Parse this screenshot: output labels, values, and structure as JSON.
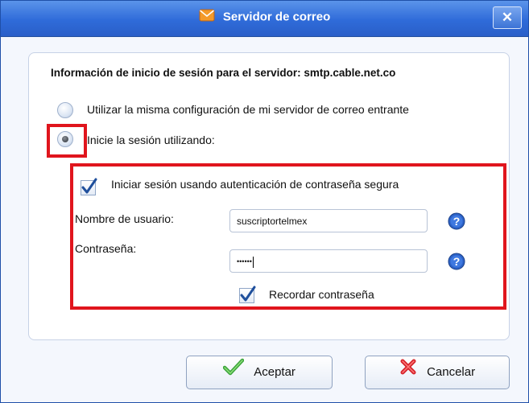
{
  "window": {
    "title": "Servidor de correo",
    "title_icon": "envelope-icon",
    "close_label": "✕"
  },
  "heading": "Información de inicio de sesión para el servidor: smtp.cable.net.co",
  "options": {
    "same_config_label": "Utilizar la misma configuración de mi servidor de correo entrante",
    "same_config_selected": false,
    "login_using_label": "Inicie la sesión utilizando:",
    "login_using_selected": true
  },
  "credentials": {
    "secure_auth_label": "Iniciar sesión usando autenticación de contraseña segura",
    "secure_auth_checked": true,
    "username_label": "Nombre de usuario:",
    "username_value": "suscriptortelmex",
    "password_label": "Contraseña:",
    "password_value": "••••••",
    "remember_label": "Recordar contraseña",
    "remember_checked": true,
    "help_icon": "help-icon"
  },
  "buttons": {
    "accept_label": "Aceptar",
    "cancel_label": "Cancelar"
  },
  "colors": {
    "highlight_border": "#e0151d",
    "titlebar": "#2f6bd9"
  }
}
